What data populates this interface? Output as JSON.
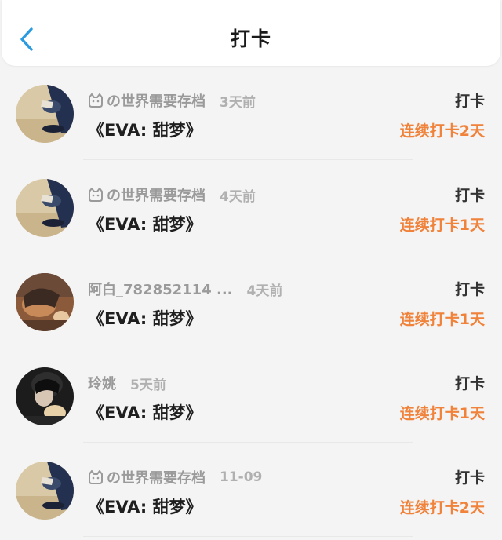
{
  "header": {
    "title": "打卡",
    "back_icon": "chevron-left-icon",
    "accent_color": "#2a9be0"
  },
  "items": [
    {
      "username": "の世界需要存档",
      "has_cat_icon": true,
      "time": "3天前",
      "content": "《EVA: 甜梦》",
      "action": "打卡",
      "streak": "连续打卡2天"
    },
    {
      "username": "の世界需要存档",
      "has_cat_icon": true,
      "time": "4天前",
      "content": "《EVA: 甜梦》",
      "action": "打卡",
      "streak": "连续打卡1天"
    },
    {
      "username": "阿白_782852114 ...",
      "has_cat_icon": false,
      "time": "4天前",
      "content": "《EVA: 甜梦》",
      "action": "打卡",
      "streak": "连续打卡1天"
    },
    {
      "username": "玲姚",
      "has_cat_icon": false,
      "time": "5天前",
      "content": "《EVA: 甜梦》",
      "action": "打卡",
      "streak": "连续打卡1天"
    },
    {
      "username": "の世界需要存档",
      "has_cat_icon": true,
      "time": "11-09",
      "content": "《EVA: 甜梦》",
      "action": "打卡",
      "streak": "连续打卡2天"
    }
  ],
  "colors": {
    "streak": "#f0823a",
    "username": "#9a9a9a",
    "time": "#b0b0b0"
  }
}
